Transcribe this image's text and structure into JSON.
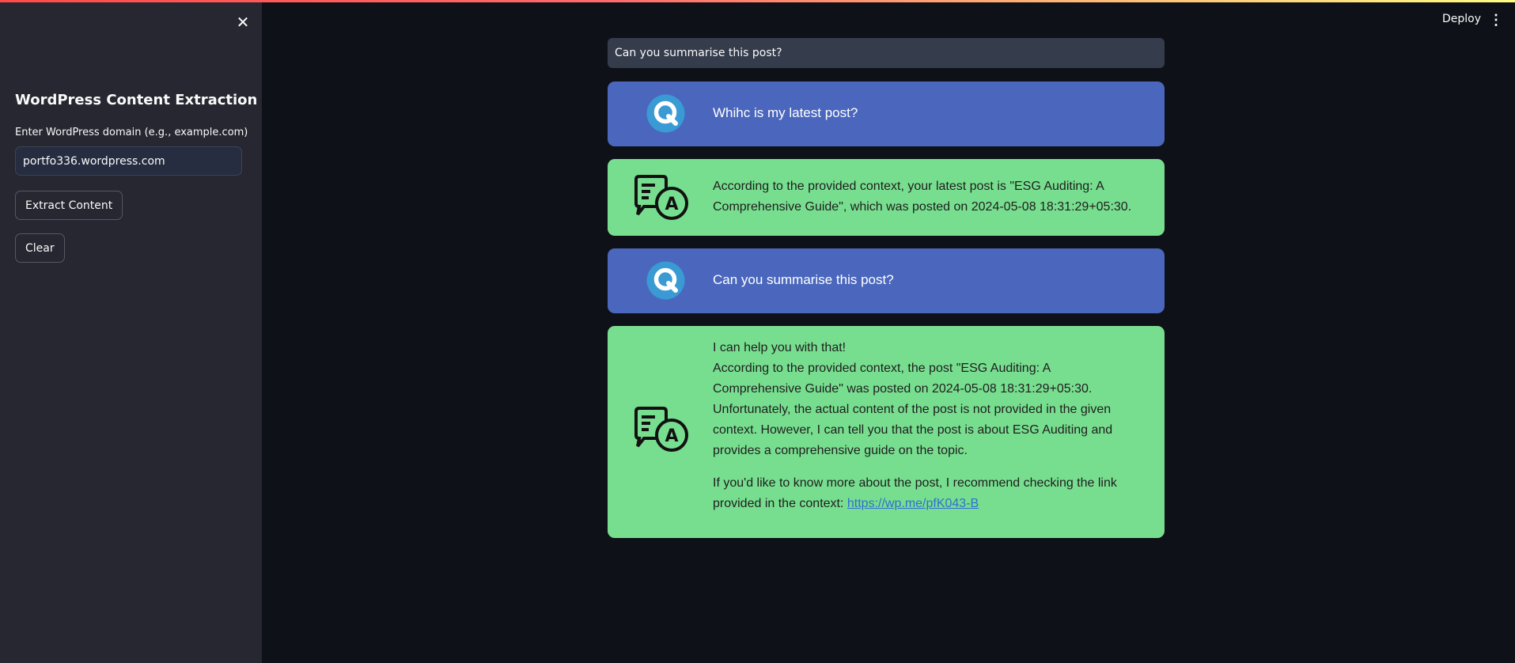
{
  "sidebar": {
    "title": "WordPress Content Extraction",
    "domain_label": "Enter WordPress domain (e.g., example.com)",
    "domain_value": "portfo336.wordpress.com",
    "extract_button": "Extract Content",
    "clear_button": "Clear"
  },
  "header": {
    "deploy_label": "Deploy"
  },
  "query_bar": {
    "text": "Can you summarise this post?"
  },
  "chat": [
    {
      "role": "question",
      "text": "Whihc is my latest post?"
    },
    {
      "role": "answer",
      "text": "According to the provided context, your latest post is \"ESG Auditing: A Comprehensive Guide\", which was posted on 2024-05-08 18:31:29+05:30."
    },
    {
      "role": "question",
      "text": "Can you summarise this post?"
    },
    {
      "role": "answer",
      "line1": "I can help you with that!",
      "line2": "According to the provided context, the post \"ESG Auditing: A Comprehensive Guide\" was posted on 2024-05-08 18:31:29+05:30. Unfortunately, the actual content of the post is not provided in the given context. However, I can tell you that the post is about ESG Auditing and provides a comprehensive guide on the topic.",
      "line3": "If you'd like to know more about the post, I recommend checking the link provided in the context: ",
      "link": "https://wp.me/pfK043-B"
    }
  ],
  "colors": {
    "background": "#0e1117",
    "sidebar": "#262730",
    "question_bubble": "#4a67bd",
    "answer_bubble": "#78de8f"
  },
  "icons": {
    "close": "close-icon",
    "menu": "kebab-menu-icon",
    "question_avatar": "q-letter-icon",
    "answer_avatar": "chat-a-icon"
  }
}
